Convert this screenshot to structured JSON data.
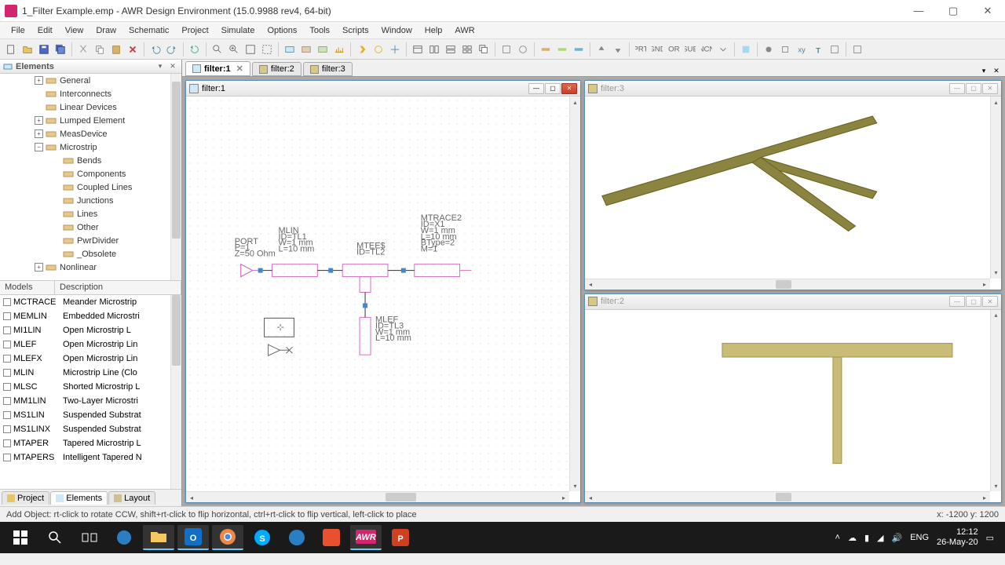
{
  "title": "1_Filter Example.emp - AWR Design Environment (15.0.9988 rev4, 64-bit)",
  "menu": [
    "File",
    "Edit",
    "View",
    "Draw",
    "Schematic",
    "Project",
    "Simulate",
    "Options",
    "Tools",
    "Scripts",
    "Window",
    "Help",
    "AWR"
  ],
  "panel": {
    "title": "Elements"
  },
  "tree": [
    {
      "indent": 44,
      "exp": "+",
      "label": "General"
    },
    {
      "indent": 44,
      "exp": "",
      "label": "Interconnects"
    },
    {
      "indent": 44,
      "exp": "",
      "label": "Linear Devices"
    },
    {
      "indent": 44,
      "exp": "+",
      "label": "Lumped Element"
    },
    {
      "indent": 44,
      "exp": "+",
      "label": "MeasDevice"
    },
    {
      "indent": 44,
      "exp": "−",
      "label": "Microstrip"
    },
    {
      "indent": 66,
      "exp": "",
      "label": "Bends"
    },
    {
      "indent": 66,
      "exp": "",
      "label": "Components"
    },
    {
      "indent": 66,
      "exp": "",
      "label": "Coupled Lines"
    },
    {
      "indent": 66,
      "exp": "",
      "label": "Junctions"
    },
    {
      "indent": 66,
      "exp": "",
      "label": "Lines"
    },
    {
      "indent": 66,
      "exp": "",
      "label": "Other"
    },
    {
      "indent": 66,
      "exp": "",
      "label": "PwrDivider"
    },
    {
      "indent": 66,
      "exp": "",
      "label": "_Obsolete"
    },
    {
      "indent": 44,
      "exp": "+",
      "label": "Nonlinear"
    }
  ],
  "models_header": {
    "c1": "Models",
    "c2": "Description"
  },
  "models": [
    {
      "name": "MCTRACE",
      "desc": "Meander Microstrip"
    },
    {
      "name": "MEMLIN",
      "desc": "Embedded Microstri"
    },
    {
      "name": "MI1LIN",
      "desc": "Open Microstrip L"
    },
    {
      "name": "MLEF",
      "desc": "Open Microstrip Lin"
    },
    {
      "name": "MLEFX",
      "desc": "Open Microstrip Lin"
    },
    {
      "name": "MLIN",
      "desc": "Microstrip Line (Clo"
    },
    {
      "name": "MLSC",
      "desc": "Shorted Microstrip L"
    },
    {
      "name": "MM1LIN",
      "desc": "Two-Layer Microstri"
    },
    {
      "name": "MS1LIN",
      "desc": "Suspended Substrat"
    },
    {
      "name": "MS1LINX",
      "desc": "Suspended Substrat"
    },
    {
      "name": "MTAPER",
      "desc": "Tapered Microstrip L"
    },
    {
      "name": "MTAPERS",
      "desc": "Intelligent Tapered N"
    }
  ],
  "bottom_tabs": [
    {
      "label": "Project",
      "active": false
    },
    {
      "label": "Elements",
      "active": true
    },
    {
      "label": "Layout",
      "active": false
    }
  ],
  "doc_tabs": [
    {
      "label": "filter:1",
      "active": true,
      "closable": true
    },
    {
      "label": "filter:2",
      "active": false
    },
    {
      "label": "filter:3",
      "active": false
    }
  ],
  "subwins": {
    "schematic": {
      "title": "filter:1"
    },
    "layout3": {
      "title": "filter:3"
    },
    "layout2": {
      "title": "filter:2"
    }
  },
  "schematic_text": {
    "port": [
      "PORT",
      "P=1",
      "Z=50 Ohm"
    ],
    "mlin": [
      "MLIN",
      "ID=TL1",
      "W=1 mm",
      "L=10 mm"
    ],
    "mtee": [
      "MTEE$",
      "ID=TL2"
    ],
    "mtrace": [
      "MTRACE2",
      "ID=X1",
      "W=1 mm",
      "L=10 mm",
      "BType=2",
      "M=1"
    ],
    "mlef": [
      "MLEF",
      "ID=TL3",
      "W=1 mm",
      "L=10 mm"
    ]
  },
  "status": {
    "left": "Add Object:   rt-click to rotate CCW, shift+rt-click to flip horizontal, ctrl+rt-click to flip vertical, left-click to place",
    "right": "x: -1200   y: 1200"
  },
  "tray": {
    "lang": "ENG",
    "time": "12:12",
    "date": "26-May-20"
  }
}
